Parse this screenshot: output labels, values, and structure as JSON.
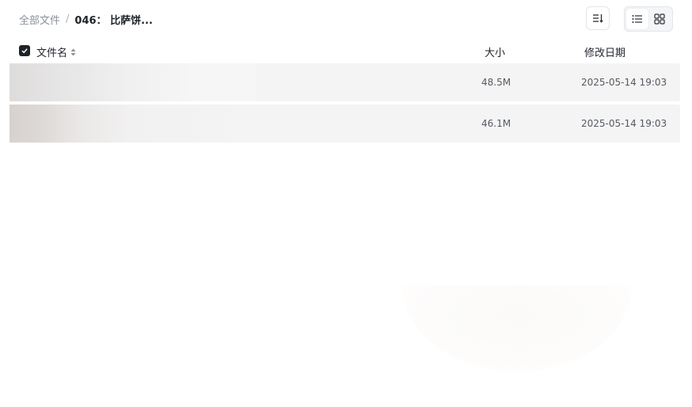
{
  "breadcrumb": {
    "root_label": "全部文件",
    "separator": "/",
    "current_label": "046： 比萨饼..."
  },
  "toolbar": {
    "sort_icon": "sort-lines-icon",
    "list_view_icon": "list-view-icon",
    "grid_view_icon": "grid-view-icon",
    "active_view": "list"
  },
  "table": {
    "select_all_checked": true,
    "columns": {
      "name": "文件名",
      "size": "大小",
      "modified": "修改日期"
    },
    "rows": [
      {
        "name": "",
        "size": "48.5M",
        "modified": "2025-05-14 19:03"
      },
      {
        "name": "",
        "size": "46.1M",
        "modified": "2025-05-14 19:03"
      }
    ]
  },
  "colors": {
    "row_background": "#f4f4f4",
    "accent_dark": "#1f2329",
    "muted_text": "#8a8f99"
  }
}
